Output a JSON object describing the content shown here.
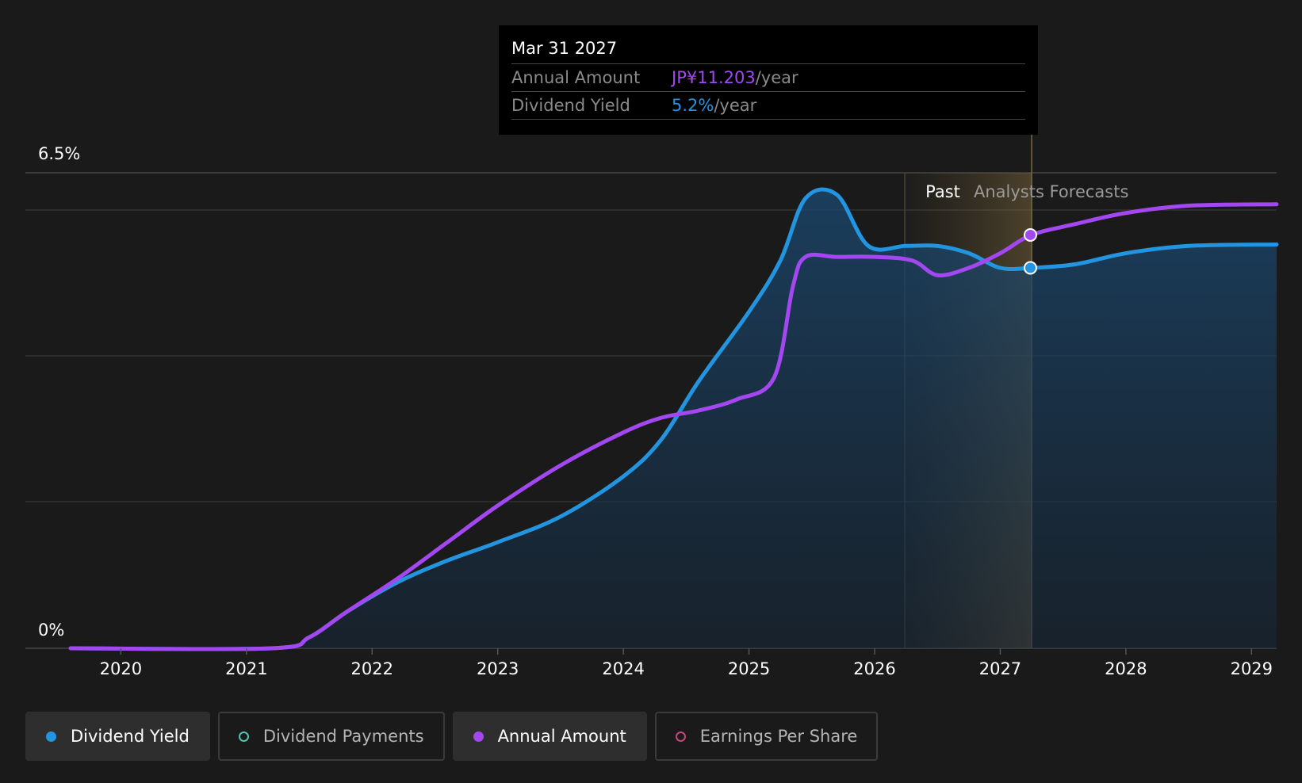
{
  "tooltip": {
    "date": "Mar 31 2027",
    "annual_amount_label": "Annual Amount",
    "annual_amount_value": "JP¥11.203",
    "dividend_yield_label": "Dividend Yield",
    "dividend_yield_value": "5.2%",
    "per_year": "/year"
  },
  "regions": {
    "past_label": "Past",
    "forecast_label": "Analysts Forecasts"
  },
  "legend": [
    {
      "label": "Dividend Yield",
      "color": "#2394df",
      "filled": true,
      "active": true
    },
    {
      "label": "Dividend Payments",
      "color": "#4fc4b4",
      "filled": false,
      "active": false
    },
    {
      "label": "Annual Amount",
      "color": "#a347f0",
      "filled": true,
      "active": true
    },
    {
      "label": "Earnings Per Share",
      "color": "#c8457f",
      "filled": false,
      "active": false
    }
  ],
  "chart_data": {
    "type": "line",
    "y_axis": {
      "range": [
        0,
        6.5
      ],
      "tick_labels": [
        "6.5%",
        "0%"
      ],
      "unit": "%"
    },
    "x_axis": {
      "range": [
        2019.24,
        2029.2
      ],
      "ticks": [
        2020,
        2021,
        2022,
        2023,
        2024,
        2025,
        2026,
        2027,
        2028,
        2029
      ]
    },
    "past_region": [
      2026.24,
      2027.25
    ],
    "colors": {
      "dividend_yield": "#2394df",
      "annual_amount": "#a347f0",
      "grid": "#333333"
    },
    "series": [
      {
        "name": "Dividend Yield",
        "color": "#2394df",
        "fill": true,
        "points": [
          [
            2019.6,
            0
          ],
          [
            2021.2,
            0
          ],
          [
            2021.5,
            0.15
          ],
          [
            2021.8,
            0.5
          ],
          [
            2022.2,
            0.9
          ],
          [
            2022.6,
            1.2
          ],
          [
            2023.0,
            1.45
          ],
          [
            2023.5,
            1.8
          ],
          [
            2024.0,
            2.35
          ],
          [
            2024.3,
            2.85
          ],
          [
            2024.6,
            3.65
          ],
          [
            2025.0,
            4.6
          ],
          [
            2025.25,
            5.3
          ],
          [
            2025.45,
            6.15
          ],
          [
            2025.7,
            6.2
          ],
          [
            2025.95,
            5.5
          ],
          [
            2026.25,
            5.5
          ],
          [
            2026.5,
            5.5
          ],
          [
            2026.75,
            5.4
          ],
          [
            2027.0,
            5.2
          ],
          [
            2027.25,
            5.2
          ],
          [
            2027.6,
            5.25
          ],
          [
            2028.0,
            5.4
          ],
          [
            2028.5,
            5.5
          ],
          [
            2029.2,
            5.52
          ]
        ]
      },
      {
        "name": "Annual Amount",
        "color": "#a347f0",
        "fill": false,
        "points": [
          [
            2019.6,
            0
          ],
          [
            2021.2,
            0
          ],
          [
            2021.5,
            0.15
          ],
          [
            2021.8,
            0.5
          ],
          [
            2022.2,
            0.95
          ],
          [
            2022.6,
            1.45
          ],
          [
            2023.0,
            1.95
          ],
          [
            2023.5,
            2.5
          ],
          [
            2024.0,
            2.95
          ],
          [
            2024.3,
            3.15
          ],
          [
            2024.6,
            3.25
          ],
          [
            2024.9,
            3.4
          ],
          [
            2025.2,
            3.7
          ],
          [
            2025.35,
            4.95
          ],
          [
            2025.45,
            5.35
          ],
          [
            2025.7,
            5.35
          ],
          [
            2026.0,
            5.35
          ],
          [
            2026.3,
            5.3
          ],
          [
            2026.5,
            5.1
          ],
          [
            2026.75,
            5.2
          ],
          [
            2027.0,
            5.4
          ],
          [
            2027.25,
            5.65
          ],
          [
            2027.6,
            5.8
          ],
          [
            2028.0,
            5.95
          ],
          [
            2028.5,
            6.05
          ],
          [
            2029.2,
            6.07
          ]
        ]
      }
    ],
    "highlight_points": [
      {
        "x": 2027.24,
        "y": 5.2,
        "color": "#2394df"
      },
      {
        "x": 2027.24,
        "y": 5.65,
        "color": "#a347f0"
      }
    ]
  }
}
